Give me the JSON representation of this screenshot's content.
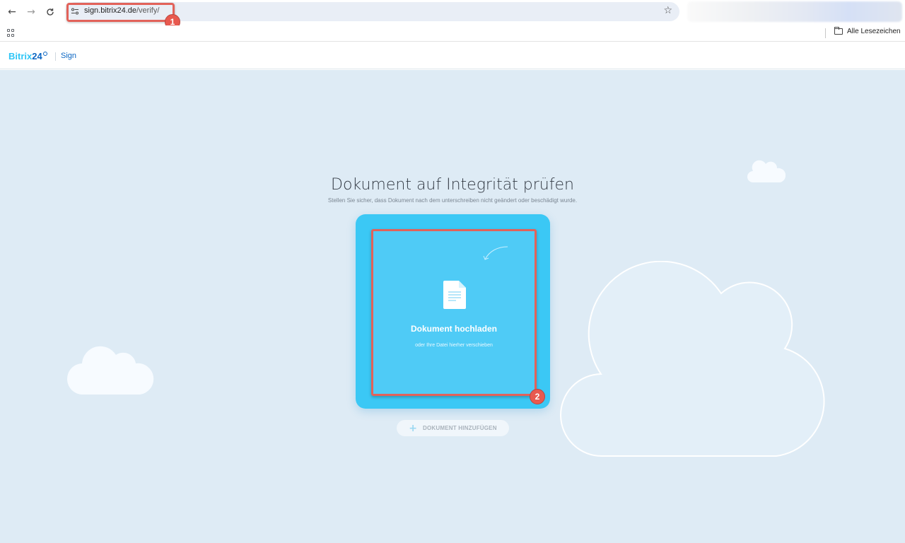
{
  "browser": {
    "url_host": "sign.bitrix24.de",
    "url_path": "/verify/",
    "bookmarks_all_label": "Alle Lesezeichen"
  },
  "header": {
    "logo_main": "Bitrix",
    "logo_num": "24",
    "product_link": "Sign"
  },
  "main": {
    "title": "Dokument auf Integrität prüfen",
    "subtitle": "Stellen Sie sicher, dass Dokument nach dem unterschreiben nicht geändert oder beschädigt wurde.",
    "upload": {
      "title": "Dokument hochladen",
      "hint": "oder Ihre Datei hierher verschieben"
    },
    "add_document_label": "DOKUMENT HINZUFÜGEN"
  },
  "annotations": {
    "badge_1": "1",
    "badge_2": "2",
    "color": "#e8594f"
  },
  "colors": {
    "brand_cyan": "#2fc6f6",
    "brand_blue": "#0b66c3",
    "page_bg": "#deebf5",
    "card_bg": "#3bc8f5"
  }
}
